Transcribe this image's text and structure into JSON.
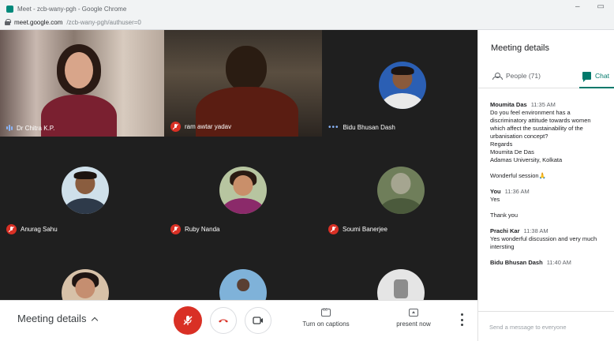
{
  "browser": {
    "title": "Meet - zcb-wany-pgh - Google Chrome",
    "url_host": "meet.google.com",
    "url_path": "/zcb-wany-pgh/authuser=0",
    "minimize_icon": "minimize-icon",
    "maximize_icon": "maximize-icon"
  },
  "tiles": [
    {
      "name": "Dr Chitra K.P.",
      "status": "speaking"
    },
    {
      "name": "ram awtar yadav",
      "status": "muted"
    },
    {
      "name": "Bidu Bhusan Dash",
      "status": "more"
    },
    {
      "name": "Anurag Sahu",
      "status": "muted"
    },
    {
      "name": "Ruby Nanda",
      "status": "muted"
    },
    {
      "name": "Soumi Banerjee",
      "status": "muted"
    }
  ],
  "toolbar": {
    "meeting_details": "Meeting details",
    "captions_label": "Turn on captions",
    "present_label": "present now",
    "mic_icon": "mic-off-icon",
    "hangup_icon": "hangup-icon",
    "camera_icon": "camera-icon"
  },
  "panel": {
    "title": "Meeting details",
    "people_tab": "People (71)",
    "chat_tab": "Chat",
    "compose_placeholder": "Send a message to everyone"
  },
  "chat": [
    {
      "sender": "Moumita Das",
      "time": "11:35 AM",
      "lines": [
        "Do you feel environment has a",
        "discriminatory attitude towards women",
        "which affect the sustainability of the",
        "urbanisation concept?",
        "Regards",
        "Moumita  De Das",
        "Adamas University, Kolkata"
      ]
    },
    {
      "sender": "",
      "time": "",
      "lines": [
        "Wonderful session🙏"
      ]
    },
    {
      "sender": "You",
      "time": "11:36 AM",
      "lines": [
        "Yes"
      ]
    },
    {
      "sender": "",
      "time": "",
      "lines": [
        "Thank you"
      ]
    },
    {
      "sender": "Prachi Kar",
      "time": "11:38 AM",
      "lines": [
        "Yes wonderful discussion and very much",
        "intersting"
      ]
    },
    {
      "sender": "Bidu Bhusan Dash",
      "time": "11:40 AM",
      "lines": []
    }
  ]
}
